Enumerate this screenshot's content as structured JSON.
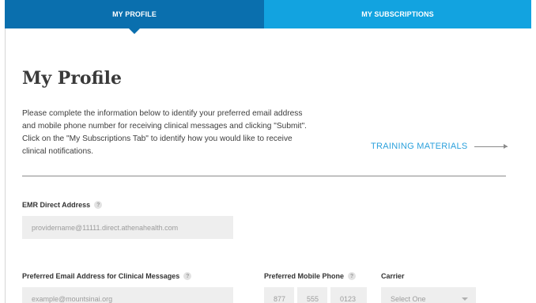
{
  "tabs": [
    {
      "label": "MY PROFILE"
    },
    {
      "label": "MY SUBSCRIPTIONS"
    }
  ],
  "page": {
    "title": "My Profile",
    "intro": "Please complete the information below to identify your preferred email address and mobile phone number for receiving clinical messages and clicking \"Submit\". Click on the \"My Subscriptions Tab\" to identify how you would like to receive clinical notifications.",
    "training_link": "TRAINING MATERIALS"
  },
  "fields": {
    "emr": {
      "label": "EMR Direct Address",
      "placeholder": "providername@11111.direct.athenahealth.com"
    },
    "email": {
      "label": "Preferred Email Address for Clinical Messages",
      "placeholder": "example@mountsinai.org"
    },
    "phone": {
      "label": "Preferred Mobile Phone",
      "area": "877",
      "prefix": "555",
      "line": "0123"
    },
    "carrier": {
      "label": "Carrier",
      "placeholder": "Select One"
    }
  },
  "help_glyph": "?",
  "colors": {
    "tab_active": "#0a6fae",
    "tab_inactive": "#12a3e0",
    "link": "#2aa0dc"
  }
}
